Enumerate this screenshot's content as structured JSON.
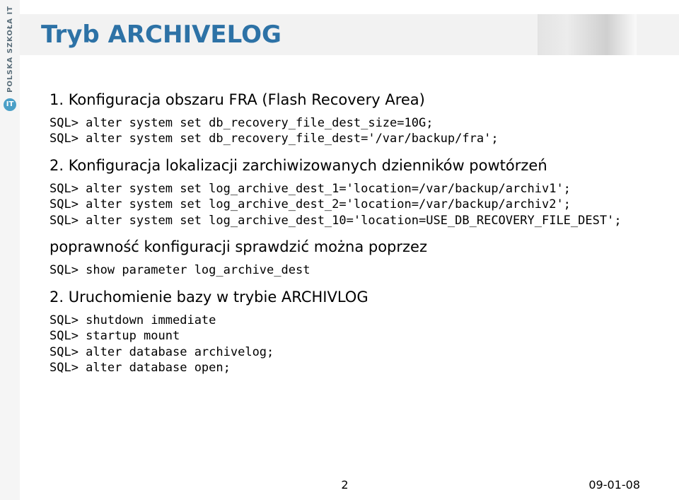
{
  "sidebar": {
    "brand_text": "POLSKA SZKOŁA IT",
    "logo_glyph": "IT"
  },
  "header": {
    "title": "Tryb ARCHIVELOG"
  },
  "sections": [
    {
      "heading": "1. Konfiguracja obszaru FRA (Flash Recovery Area)",
      "code": "SQL> alter system set db_recovery_file_dest_size=10G;\nSQL> alter system set db_recovery_file_dest='/var/backup/fra';"
    },
    {
      "heading": "2. Konfiguracja lokalizacji zarchiwizowanych dzienników powtórzeń",
      "code": "SQL> alter system set log_archive_dest_1='location=/var/backup/archiv1';\nSQL> alter system set log_archive_dest_2='location=/var/backup/archiv2';\nSQL> alter system set log_archive_dest_10='location=USE_DB_RECOVERY_FILE_DEST';"
    },
    {
      "heading": "poprawność konfiguracji sprawdzić można poprzez",
      "code": "SQL> show parameter log_archive_dest"
    },
    {
      "heading": "2. Uruchomienie bazy w trybie ARCHIVLOG",
      "code": "SQL> shutdown immediate\nSQL> startup mount\nSQL> alter database archivelog;\nSQL> alter database open;"
    }
  ],
  "footer": {
    "page": "2",
    "date": "09-01-08"
  }
}
